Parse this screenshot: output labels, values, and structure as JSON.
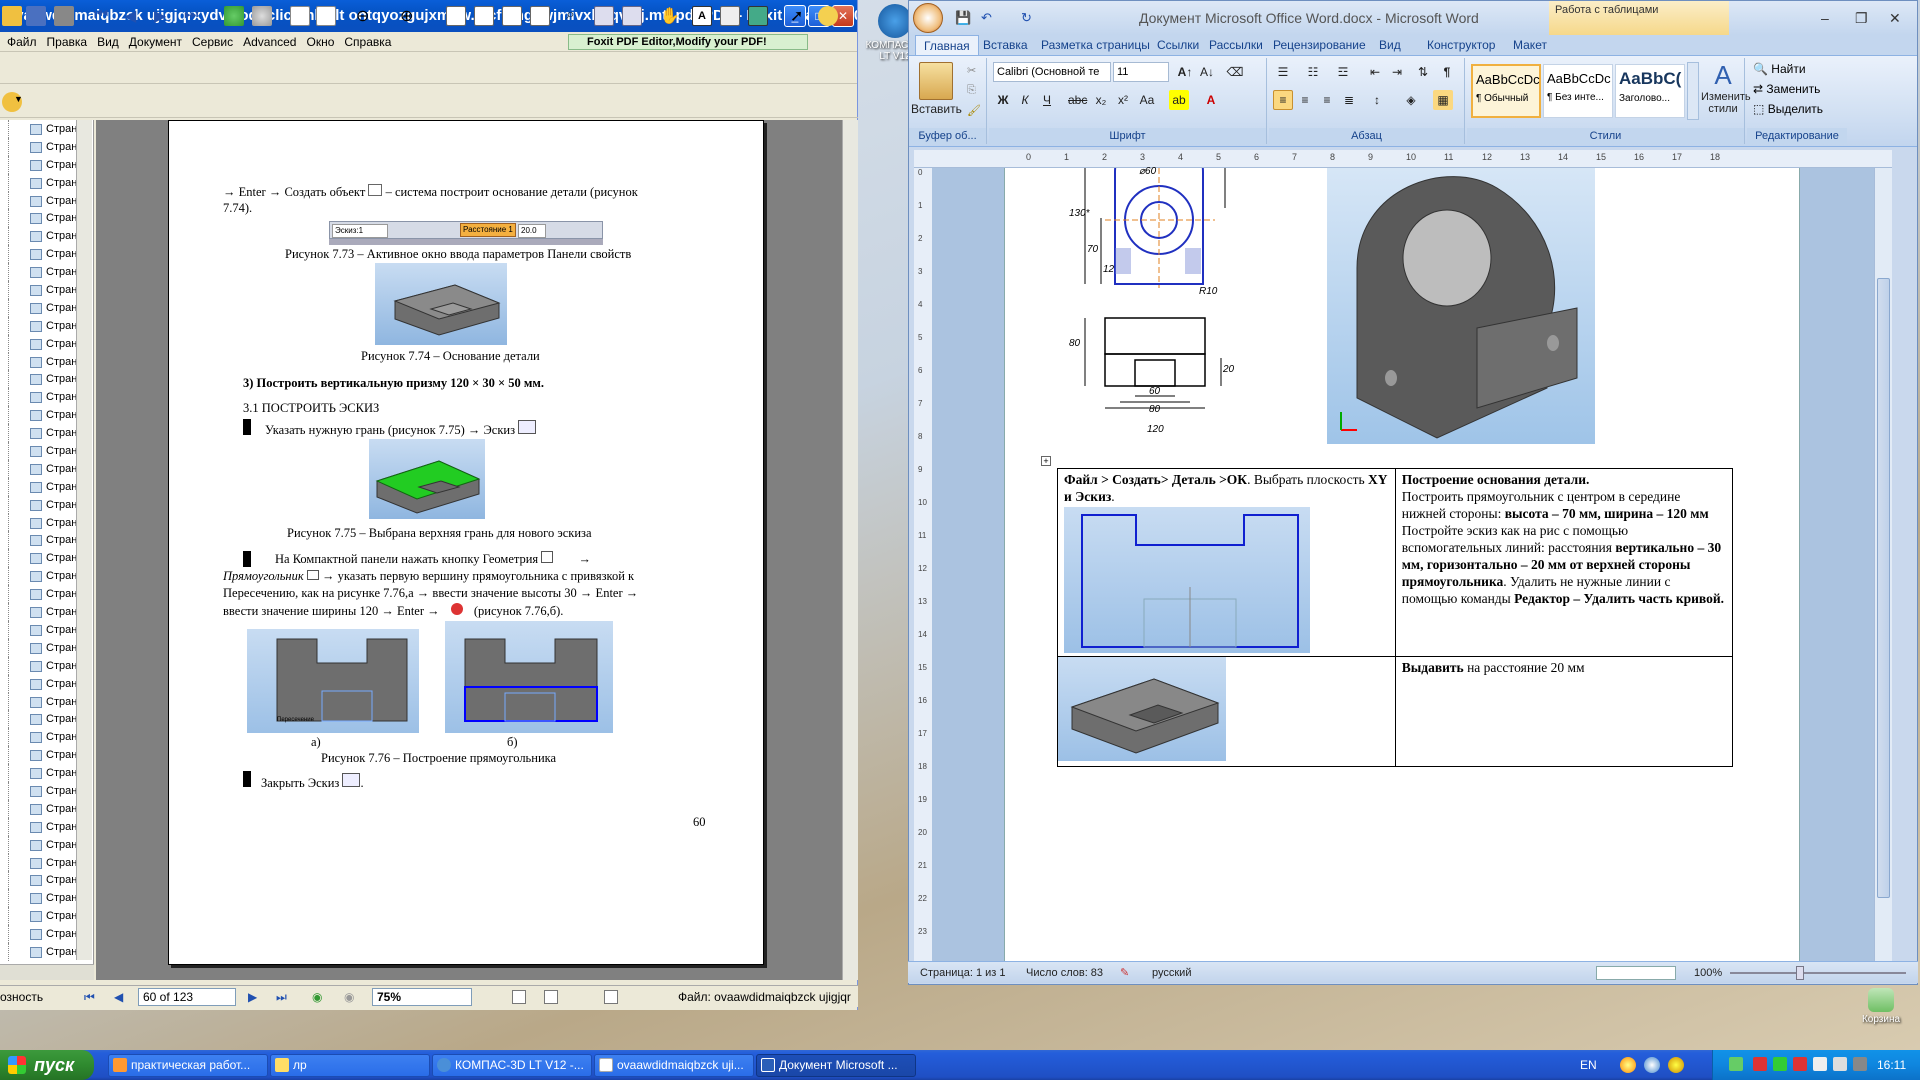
{
  "desktop": {
    "icon_kompas": "КОМПАС-3D LT V12",
    "icon_recycle": "Корзина"
  },
  "foxit": {
    "title": "ovaawdidmaiqbzck ujigjqrxydvj. oqhclichmlkylt ontqyozgujxmhw. pcfetngewjmivxhgqv uj.mt. pdf.PDF - Foxit Reader 2.0 ...",
    "menu": [
      "Файл",
      "Правка",
      "Вид",
      "Документ",
      "Сервис",
      "Advanced",
      "Окно",
      "Справка"
    ],
    "promo": "Foxit PDF Editor,Modify your PDF!",
    "nav_item_label": "Стран",
    "nav_count": 47,
    "page_indicator": "60 of 123",
    "zoom": "75%",
    "status_left": "озность",
    "status_file": "Файл: ovaawdidmaiqbzck ujigjqr"
  },
  "pdf": {
    "line1": "→ Enter → Создать объект",
    "line1b": "– система построит основание детали (рисунок",
    "line1c": "7.74).",
    "panel_field1": "Эскиз:1",
    "panel_dist": "Расстояние 1",
    "panel_val": "20.0",
    "cap73": "Рисунок 7.73 – Активное окно ввода параметров  Панели свойств",
    "cap74": "Рисунок 7.74 – Основание детали",
    "step3": "3)        Построить вертикальную призму 120 × 30 × 50 мм.",
    "sub31": "3.1  ПОСТРОИТЬ ЭСКИЗ",
    "b1": "Указать нужную грань  (рисунок 7.75) → Эскиз",
    "cap75": "Рисунок 7.75 – Выбрана верхняя грань для нового эскиза",
    "p2a": "На   Компактной   панели   нажать   кнопку   Геометрия",
    "p2b": "Прямоугольник",
    "p2c": "→ указать первую вершину прямоугольника с привязкой к",
    "p2d": "Пересечению, как на рисунке 7.76,а   → ввести значение высоты 30 → Enter →",
    "p2e": "ввести значение ширины 120 →  Enter →",
    "p2f": "(рисунок 7.76,б).",
    "label_peresech": "Пересечение",
    "sub_a": "а)",
    "sub_b": "б)",
    "cap76": "Рисунок 7.76 – Построение прямоугольника",
    "close": "Закрыть  Эскиз",
    "page_no": "60"
  },
  "word": {
    "title": "Документ Microsoft Office Word.docx - Microsoft Word",
    "context_tab": "Работа с таблицами",
    "tabs": [
      "Главная",
      "Вставка",
      "Разметка страницы",
      "Ссылки",
      "Рассылки",
      "Рецензирование",
      "Вид",
      "Конструктор",
      "Макет"
    ],
    "paste": "Вставить",
    "font_name": "Calibri (Основной те",
    "font_size": "11",
    "styles": [
      "¶ Обычный",
      "¶ Без инте...",
      "Заголово..."
    ],
    "style_sample": [
      "AaBbCcDc",
      "AaBbCcDc",
      "AaBbC("
    ],
    "change_styles": "Изменить стили",
    "find": "Найти",
    "replace": "Заменить",
    "select": "Выделить",
    "groups": [
      "Буфер об...",
      "Шрифт",
      "Абзац",
      "Стили",
      "Редактирование"
    ],
    "status_page": "Страница: 1 из 1",
    "status_words": "Число слов: 83",
    "status_lang": "русский",
    "status_zoom": "100%",
    "dims": [
      "⌀60",
      "130*",
      "70",
      "12",
      "R10",
      "80",
      "60",
      "80",
      "120",
      "20"
    ],
    "cell1_a": "Файл > Создать> Деталь >ОК",
    "cell1_b": ". Выбрать плоскость ",
    "cell1_c": "XY и Эскиз",
    "cell1_d": ".",
    "cell2_title": "Построение основания детали.",
    "cell2_text1": "Построить прямоугольник с центром в середине нижней стороны: ",
    "cell2_b1": "высота – 70 мм, ширина – 120 мм",
    "cell2_text2": " Постройте эскиз как на рис с помощью вспомогательных линий: расстояния ",
    "cell2_b2": "вертикально – 30 мм, горизонтально – 20 мм от верхней стороны прямоугольника",
    "cell2_text3": ". Удалить не нужные линии с помощью команды ",
    "cell2_b3": "Редактор – Удалить часть кривой.",
    "cell4_b": "Выдавить",
    "cell4_t": " на расстояние 20 мм"
  },
  "taskbar": {
    "start": "пуск",
    "tasks": [
      "практическая работ...",
      "лр",
      "КОМПАС-3D LT V12 -...",
      "ovaawdidmaiqbzck uji...",
      "Документ Microsoft ..."
    ],
    "lang": "EN",
    "time": "16:11"
  }
}
